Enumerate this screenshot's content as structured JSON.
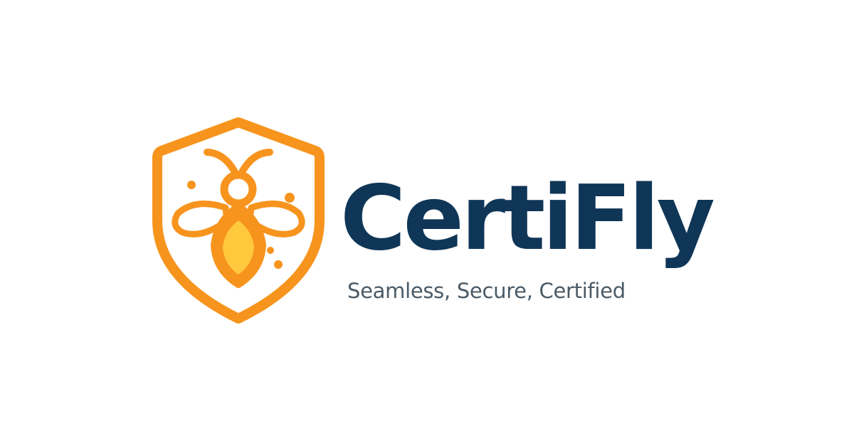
{
  "brand": {
    "name": "CertiFly",
    "tagline": "Seamless, Secure, Certified"
  },
  "colors": {
    "background": "#ffffff",
    "shield_orange": "#F7941D",
    "bee_body_yellow": "#FFC83D",
    "wordmark_navy": "#0F3657",
    "tagline_gray": "#4A5A66"
  },
  "icons": {
    "emblem": "shield-bee-icon"
  }
}
